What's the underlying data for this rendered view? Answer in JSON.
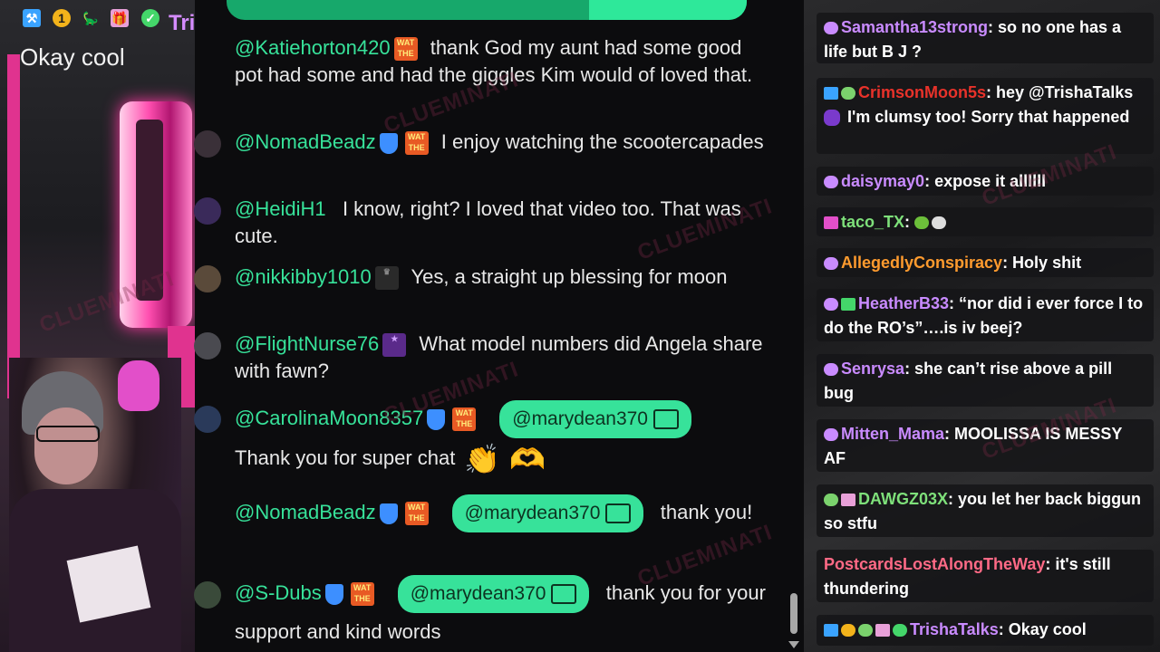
{
  "overlay": {
    "streamer_name": "TrishaTalks",
    "chat_text": "Okay cool",
    "badge_count": "1"
  },
  "watermark": "CLUEMINATI",
  "colors": {
    "accent_green": "#37e29a",
    "pill_text": "#0d3321",
    "rightbg": "#161618"
  },
  "main_chat": [
    {
      "user": "@Katiehorton420",
      "text": "thank God my aunt had some good pot had some and had the giggles Kim would of loved that."
    },
    {
      "user": "@NomadBeadz",
      "text": "I enjoy watching the scootercapades"
    },
    {
      "user": "@HeidiH1",
      "text": "I know, right? I loved that video too. That was cute."
    },
    {
      "user": "@nikkibby1010",
      "text": "Yes, a straight up blessing for moon"
    },
    {
      "user": "@FlightNurse76",
      "text": "What model numbers did Angela share with fawn?"
    },
    {
      "user": "@CarolinaMoon8357",
      "mention": "@marydean370",
      "text": "Thank you for super chat"
    },
    {
      "user": "@NomadBeadz",
      "mention": "@marydean370",
      "text": "thank you!"
    },
    {
      "user": "@S-Dubs",
      "mention": "@marydean370",
      "text": "thank you for your support and kind words"
    }
  ],
  "side_chat": [
    {
      "user": "Samantha13strong",
      "color": "#c98bff",
      "text": ": so no one has a life but B J ?"
    },
    {
      "user": "CrimsonMoon5s",
      "color": "#e8322a",
      "text": ": hey @TrishaTalks",
      "text2": "I'm clumsy too! Sorry that happened"
    },
    {
      "user": "daisymay0",
      "color": "#c98bff",
      "text": ": expose it allllll"
    },
    {
      "user": "taco_TX",
      "color": "#7ee07a",
      "text": ":"
    },
    {
      "user": "AllegedlyConspiracy",
      "color": "#ff9b2e",
      "text": ": Holy shit"
    },
    {
      "user": "HeatherB33",
      "color": "#c98bff",
      "text": ": “nor did i ever force I to do the RO’s”….is iv beej?"
    },
    {
      "user": "Senrysa",
      "color": "#c98bff",
      "text": ": she can’t rise above a pill bug"
    },
    {
      "user": "Mitten_Mama",
      "color": "#c98bff",
      "text": ": MOOLISSA IS MESSY AF"
    },
    {
      "user": "DAWGZ03X",
      "color": "#7ee07a",
      "text": ": you let her back biggun so stfu"
    },
    {
      "user": "PostcardsLostAlongTheWay",
      "color": "#ff6a86",
      "text": ": it's still thundering"
    },
    {
      "user": "TrishaTalks",
      "color": "#c98bff",
      "text": ": Okay cool"
    }
  ]
}
